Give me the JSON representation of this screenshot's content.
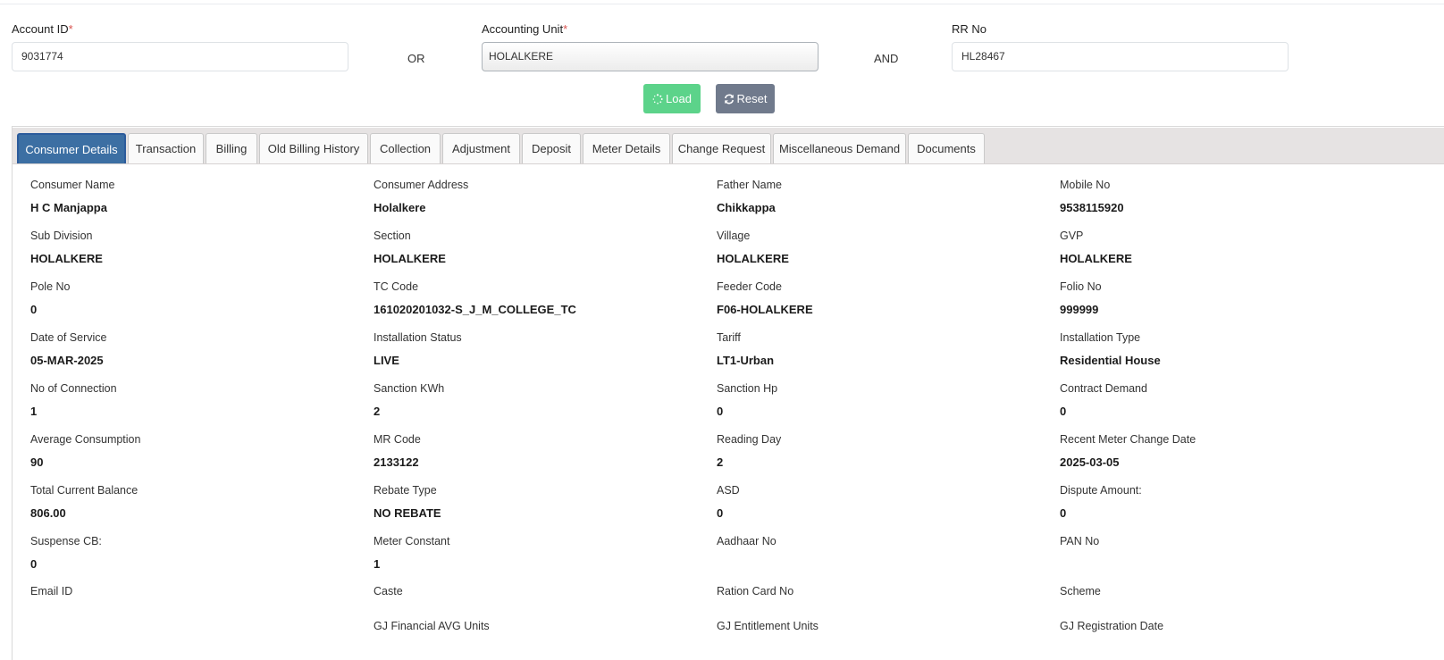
{
  "filters": {
    "account_id": {
      "label": "Account ID",
      "required": "*",
      "value": "9031774"
    },
    "or_label": "OR",
    "accounting_unit": {
      "label": "Accounting Unit",
      "required": "*",
      "value": "HOLALKERE"
    },
    "and_label": "AND",
    "rr_no": {
      "label": "RR No",
      "value": "HL28467"
    }
  },
  "buttons": {
    "load": "Load",
    "reset": "Reset"
  },
  "colors": {
    "load": "#5cd38a",
    "reset": "#707a8c",
    "active_tab": "#3c6fa3",
    "required": "#d9534f"
  },
  "tabs": [
    {
      "label": "Consumer Details"
    },
    {
      "label": "Transaction"
    },
    {
      "label": "Billing"
    },
    {
      "label": "Old Billing History"
    },
    {
      "label": "Collection"
    },
    {
      "label": "Adjustment"
    },
    {
      "label": "Deposit"
    },
    {
      "label": "Meter Details"
    },
    {
      "label": "Change Request"
    },
    {
      "label": "Miscellaneous Demand"
    },
    {
      "label": "Documents"
    }
  ],
  "details": [
    {
      "label": "Consumer Name",
      "value": "H C Manjappa"
    },
    {
      "label": "Consumer Address",
      "value": "Holalkere"
    },
    {
      "label": "Father Name",
      "value": "Chikkappa"
    },
    {
      "label": "Mobile No",
      "value": "9538115920"
    },
    {
      "label": "Sub Division",
      "value": "HOLALKERE"
    },
    {
      "label": "Section",
      "value": "HOLALKERE"
    },
    {
      "label": "Village",
      "value": "HOLALKERE"
    },
    {
      "label": "GVP",
      "value": "HOLALKERE"
    },
    {
      "label": "Pole No",
      "value": "0"
    },
    {
      "label": "TC Code",
      "value": "161020201032-S_J_M_COLLEGE_TC"
    },
    {
      "label": "Feeder Code",
      "value": "F06-HOLALKERE"
    },
    {
      "label": "Folio No",
      "value": "999999"
    },
    {
      "label": "Date of Service",
      "value": "05-MAR-2025"
    },
    {
      "label": "Installation Status",
      "value": "LIVE"
    },
    {
      "label": "Tariff",
      "value": "LT1-Urban"
    },
    {
      "label": "Installation Type",
      "value": "Residential House"
    },
    {
      "label": "No of Connection",
      "value": "1"
    },
    {
      "label": "Sanction KWh",
      "value": "2"
    },
    {
      "label": "Sanction Hp",
      "value": "0"
    },
    {
      "label": "Contract Demand",
      "value": "0"
    },
    {
      "label": "Average Consumption",
      "value": "90"
    },
    {
      "label": "MR Code",
      "value": "2133122"
    },
    {
      "label": "Reading Day",
      "value": "2"
    },
    {
      "label": "Recent Meter Change Date",
      "value": "2025-03-05"
    },
    {
      "label": "Total Current Balance",
      "value": "806.00"
    },
    {
      "label": "Rebate Type",
      "value": "NO REBATE"
    },
    {
      "label": "ASD",
      "value": "0"
    },
    {
      "label": "Dispute Amount:",
      "value": "0"
    },
    {
      "label": "Suspense CB:",
      "value": "0"
    },
    {
      "label": "Meter Constant",
      "value": "1"
    },
    {
      "label": "Aadhaar No",
      "value": ""
    },
    {
      "label": "PAN No",
      "value": ""
    },
    {
      "label": "Email ID",
      "value": ""
    },
    {
      "label": "Caste",
      "value": ""
    },
    {
      "label": "Ration Card No",
      "value": ""
    },
    {
      "label": "Scheme",
      "value": ""
    },
    {
      "label": "GJ Financial AVG Units",
      "value": ""
    },
    {
      "label": "GJ Entitlement Units",
      "value": ""
    },
    {
      "label": "GJ Registration Date",
      "value": ""
    }
  ]
}
